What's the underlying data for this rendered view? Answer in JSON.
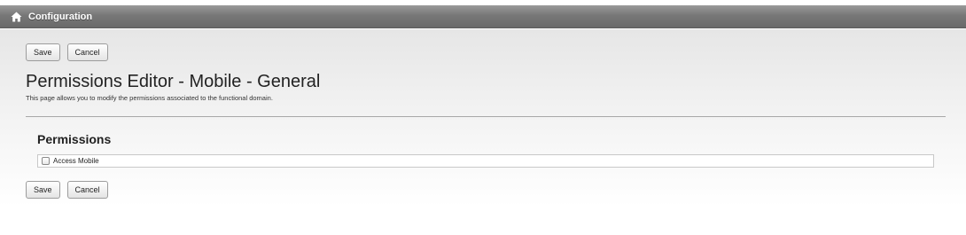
{
  "header": {
    "title": "Configuration",
    "home_icon": "home-icon"
  },
  "toolbar_top": {
    "save_label": "Save",
    "cancel_label": "Cancel"
  },
  "page": {
    "title": "Permissions Editor - Mobile - General",
    "description": "This page allows you to modify the permissions associated to the functional domain."
  },
  "permissions": {
    "section_title": "Permissions",
    "items": [
      {
        "label": "Access Mobile",
        "checked": false
      }
    ]
  },
  "toolbar_bottom": {
    "save_label": "Save",
    "cancel_label": "Cancel"
  }
}
